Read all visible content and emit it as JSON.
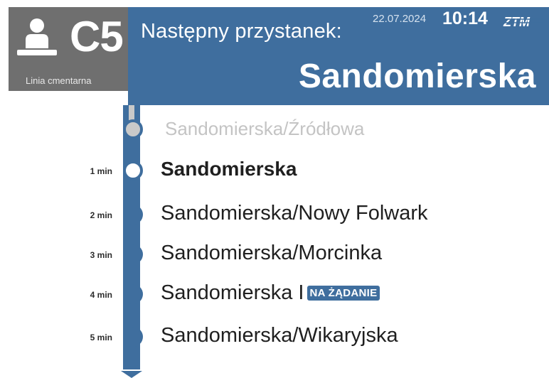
{
  "line": {
    "number": "C5",
    "name": "Linia cmentarna",
    "icon": "person-icon"
  },
  "header": {
    "next_label": "Następny przystanek:",
    "date": "22.07.2024",
    "time": "10:14",
    "operator_logo": "ZTM",
    "next_stop": "Sandomierska"
  },
  "stops": [
    {
      "name": "Sandomierska/Źródłowa",
      "eta": "",
      "state": "passed"
    },
    {
      "name": "Sandomierska",
      "eta": "1 min",
      "state": "current"
    },
    {
      "name": "Sandomierska/Nowy Folwark",
      "eta": "2 min",
      "state": "upcoming"
    },
    {
      "name": "Sandomierska/Morcinka",
      "eta": "3 min",
      "state": "upcoming"
    },
    {
      "name": "Sandomierska I",
      "eta": "4 min",
      "state": "upcoming",
      "badge": "NA ŻĄDANIE"
    },
    {
      "name": "Sandomierska/Wikaryjska",
      "eta": "5 min",
      "state": "upcoming"
    }
  ],
  "colors": {
    "accent": "#3f6e9e",
    "badge_bg": "#6f6f6f",
    "passed": "#c9c9c9"
  }
}
